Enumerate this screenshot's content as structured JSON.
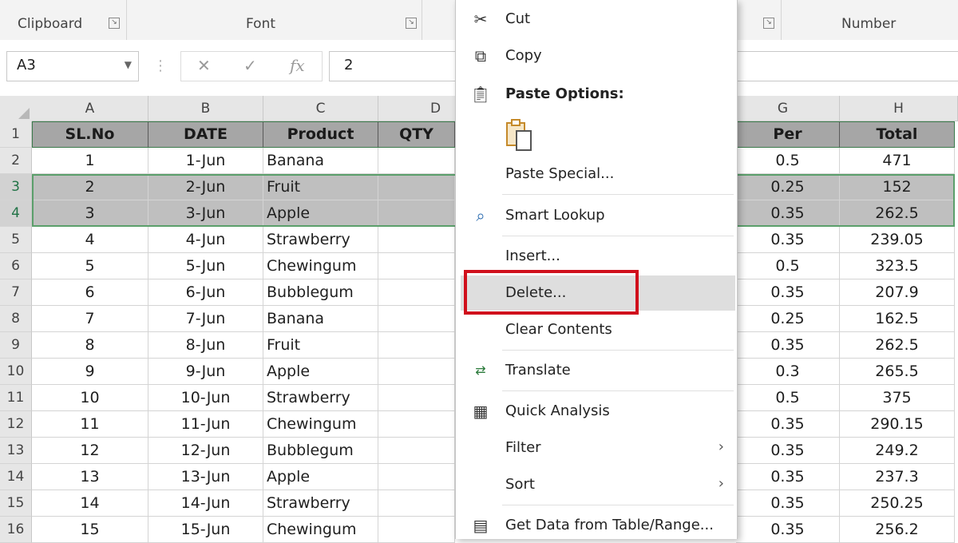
{
  "ribbon": {
    "groups": [
      {
        "label": "Clipboard"
      },
      {
        "label": "Font"
      },
      {
        "label": "Number"
      }
    ]
  },
  "formula_bar": {
    "name_box": "A3",
    "formula_value": "2",
    "icons": [
      "cancel-icon",
      "enter-icon",
      "function-icon"
    ]
  },
  "columns": [
    "A",
    "B",
    "C",
    "D",
    "G",
    "H"
  ],
  "header_row": {
    "row": "1",
    "cells": [
      "SL.No",
      "DATE",
      "Product",
      "QTY",
      "Per",
      "Total"
    ]
  },
  "rows": [
    {
      "row": "2",
      "sl": "1",
      "date": "1-Jun",
      "product": "Banana",
      "per": "0.5",
      "total": "471"
    },
    {
      "row": "3",
      "sl": "2",
      "date": "2-Jun",
      "product": "Fruit",
      "per": "0.25",
      "total": "152"
    },
    {
      "row": "4",
      "sl": "3",
      "date": "3-Jun",
      "product": "Apple",
      "per": "0.35",
      "total": "262.5"
    },
    {
      "row": "5",
      "sl": "4",
      "date": "4-Jun",
      "product": "Strawberry",
      "per": "0.35",
      "total": "239.05"
    },
    {
      "row": "6",
      "sl": "5",
      "date": "5-Jun",
      "product": "Chewingum",
      "per": "0.5",
      "total": "323.5"
    },
    {
      "row": "7",
      "sl": "6",
      "date": "6-Jun",
      "product": "Bubblegum",
      "per": "0.35",
      "total": "207.9"
    },
    {
      "row": "8",
      "sl": "7",
      "date": "7-Jun",
      "product": "Banana",
      "per": "0.25",
      "total": "162.5"
    },
    {
      "row": "9",
      "sl": "8",
      "date": "8-Jun",
      "product": "Fruit",
      "per": "0.35",
      "total": "262.5"
    },
    {
      "row": "10",
      "sl": "9",
      "date": "9-Jun",
      "product": "Apple",
      "per": "0.3",
      "total": "265.5"
    },
    {
      "row": "11",
      "sl": "10",
      "date": "10-Jun",
      "product": "Strawberry",
      "per": "0.5",
      "total": "375"
    },
    {
      "row": "12",
      "sl": "11",
      "date": "11-Jun",
      "product": "Chewingum",
      "per": "0.35",
      "total": "290.15"
    },
    {
      "row": "13",
      "sl": "12",
      "date": "12-Jun",
      "product": "Bubblegum",
      "per": "0.35",
      "total": "249.2"
    },
    {
      "row": "14",
      "sl": "13",
      "date": "13-Jun",
      "product": "Apple",
      "per": "0.35",
      "total": "237.3"
    },
    {
      "row": "15",
      "sl": "14",
      "date": "14-Jun",
      "product": "Strawberry",
      "per": "0.35",
      "total": "250.25"
    },
    {
      "row": "16",
      "sl": "15",
      "date": "15-Jun",
      "product": "Chewingum",
      "per": "0.35",
      "total": "256.2"
    }
  ],
  "selected_rows": [
    "3",
    "4"
  ],
  "context_menu": {
    "cut": "Cut",
    "copy": "Copy",
    "paste_options": "Paste Options:",
    "paste_special": "Paste Special...",
    "smart_lookup": "Smart Lookup",
    "insert": "Insert...",
    "delete": "Delete...",
    "clear_contents": "Clear Contents",
    "translate": "Translate",
    "quick_analysis": "Quick Analysis",
    "filter": "Filter",
    "sort": "Sort",
    "get_data": "Get Data from Table/Range..."
  },
  "colors": {
    "header_fill": "#a6a6a6",
    "selection_fill": "#bfbfbf",
    "selection_border": "#5b9f6b",
    "highlight_box": "#d0101c",
    "menu_hover": "#dedede"
  }
}
